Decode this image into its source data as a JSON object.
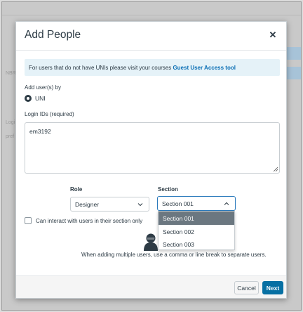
{
  "modal": {
    "title": "Add People",
    "close_icon": "close-icon"
  },
  "info": {
    "text": "For users that do not have UNIs please visit your courses ",
    "link": "Guest User Access tool"
  },
  "add_by": {
    "label": "Add user(s) by",
    "option": "UNI"
  },
  "login_ids": {
    "label": "Login IDs (required)",
    "value": "em3192"
  },
  "role": {
    "label": "Role",
    "selected": "Designer"
  },
  "section": {
    "label": "Section",
    "selected": "Section 001",
    "options": [
      "Section 001",
      "Section 002",
      "Section 003"
    ]
  },
  "checkbox": {
    "label": "Can interact with users in their section only",
    "checked": false
  },
  "help_text": "When adding multiple users, use a comma or line break to separate users.",
  "footer": {
    "cancel_label": "Cancel",
    "next_label": "Next"
  },
  "colors": {
    "primary": "#0770a3",
    "link": "#0b6fb5",
    "info_bg": "#e5f2f8",
    "selected_option": "#6b7780"
  }
}
